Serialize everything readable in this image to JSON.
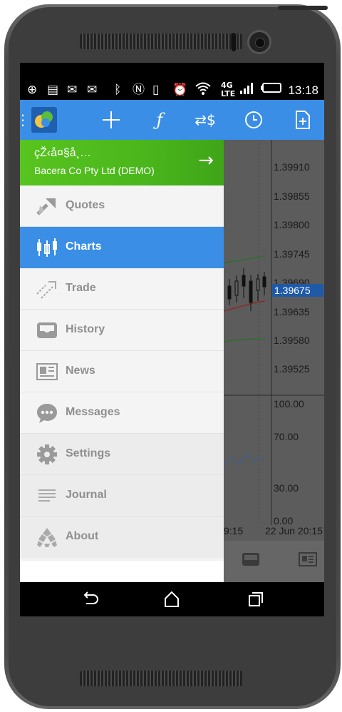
{
  "status_bar": {
    "time": "13:18",
    "icons": [
      "plus-icon",
      "image-icon",
      "gmail-icon",
      "mail-check-icon",
      "bluetooth-icon",
      "nfc-icon",
      "vibrate-icon",
      "alarm-icon",
      "wifi-icon",
      "4g-lte-icon",
      "signal-icon",
      "battery-icon"
    ]
  },
  "app_bar": {
    "icons": [
      "menu-icon",
      "metatrader-logo",
      "crosshair-icon",
      "function-icon",
      "currency-icon",
      "clock-icon",
      "new-document-icon"
    ]
  },
  "drawer": {
    "account_name": "çŽ‹å¤§å¸…",
    "account_sub": "Bacera Co Pty Ltd (DEMO)",
    "items": [
      {
        "label": "Quotes",
        "icon": "quotes-icon"
      },
      {
        "label": "Charts",
        "icon": "charts-icon"
      },
      {
        "label": "Trade",
        "icon": "trade-icon"
      },
      {
        "label": "History",
        "icon": "history-icon"
      },
      {
        "label": "News",
        "icon": "news-icon"
      },
      {
        "label": "Messages",
        "icon": "messages-icon"
      },
      {
        "label": "Settings",
        "icon": "settings-icon"
      },
      {
        "label": "Journal",
        "icon": "journal-icon"
      },
      {
        "label": "About",
        "icon": "about-icon"
      }
    ],
    "active_index": 1
  },
  "chart": {
    "price_levels": [
      "1.39910",
      "1.39855",
      "1.39800",
      "1.39745",
      "1.39690",
      "1.39635",
      "1.39580",
      "1.39525"
    ],
    "current_price": "1.39675",
    "indicator_levels": [
      "100.00",
      "70.00",
      "30.00",
      "0.00"
    ],
    "time_labels": [
      "9:15",
      "22 Jun 20:15"
    ]
  },
  "colors": {
    "app_bar": "#3a8ee6",
    "drawer_header": "#4ab61c",
    "active_item": "#3a8ee6",
    "price_tag": "#1e5aa8"
  }
}
